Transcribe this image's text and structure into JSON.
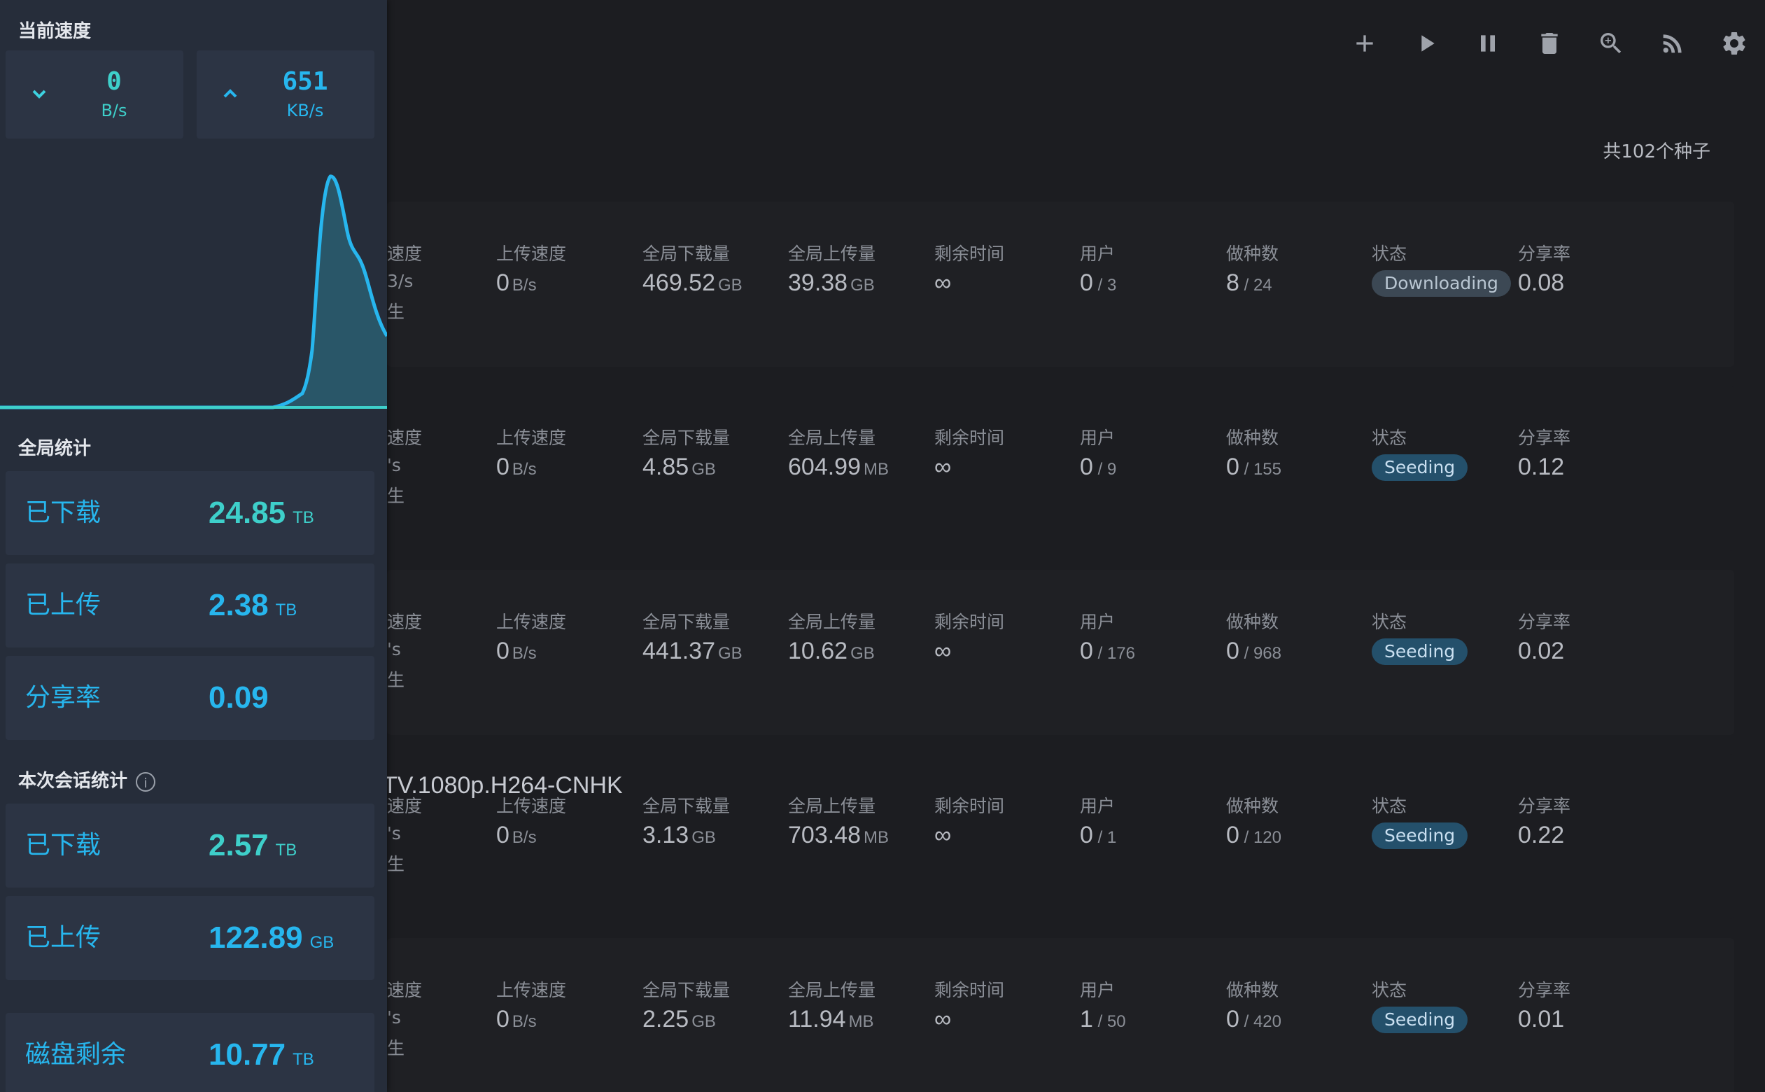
{
  "sidebar": {
    "speed_title": "当前速度",
    "download_speed": {
      "value": "0",
      "unit": "B/s"
    },
    "upload_speed": {
      "value": "651",
      "unit": "KB/s"
    },
    "global_title": "全局统计",
    "global": [
      {
        "label": "已下载",
        "value": "24.85",
        "unit": "TB"
      },
      {
        "label": "已上传",
        "value": "2.38",
        "unit": "TB"
      },
      {
        "label": "分享率",
        "value": "0.09",
        "unit": ""
      }
    ],
    "session_title": "本次会话统计",
    "session_info_icon": "info-icon",
    "session": [
      {
        "label": "已下载",
        "value": "2.57",
        "unit": "TB"
      },
      {
        "label": "已上传",
        "value": "122.89",
        "unit": "GB"
      }
    ],
    "disk": {
      "label": "磁盘剩余",
      "value": "10.77",
      "unit": "TB"
    }
  },
  "toolbar": {
    "icons": [
      "add-icon",
      "play-icon",
      "pause-icon",
      "delete-icon",
      "search-icon",
      "rss-icon",
      "gear-icon"
    ]
  },
  "total_label": "共102个种子",
  "columns": {
    "dl_speed": "速度",
    "ul_speed": "上传速度",
    "downloaded": "全局下载量",
    "uploaded": "全局上传量",
    "eta": "剩余时间",
    "peers": "用户",
    "seeds": "做种数",
    "status": "状态",
    "ratio": "分享率"
  },
  "torrents": [
    {
      "name": "",
      "dl_speed": "3/s",
      "extra": "生",
      "ul_value": "0",
      "ul_unit": "B/s",
      "downloaded": "469.52",
      "downloaded_unit": "GB",
      "uploaded": "39.38",
      "uploaded_unit": "GB",
      "eta": "∞",
      "peers": "0",
      "peers_total": "3",
      "seeds": "8",
      "seeds_total": "24",
      "status": "Downloading",
      "ratio": "0.08"
    },
    {
      "name": "",
      "dl_speed": "'s",
      "extra": "生",
      "ul_value": "0",
      "ul_unit": "B/s",
      "downloaded": "4.85",
      "downloaded_unit": "GB",
      "uploaded": "604.99",
      "uploaded_unit": "MB",
      "eta": "∞",
      "peers": "0",
      "peers_total": "9",
      "seeds": "0",
      "seeds_total": "155",
      "status": "Seeding",
      "ratio": "0.12"
    },
    {
      "name": "",
      "dl_speed": "'s",
      "extra": "生",
      "ul_value": "0",
      "ul_unit": "B/s",
      "downloaded": "441.37",
      "downloaded_unit": "GB",
      "uploaded": "10.62",
      "uploaded_unit": "GB",
      "eta": "∞",
      "peers": "0",
      "peers_total": "176",
      "seeds": "0",
      "seeds_total": "968",
      "status": "Seeding",
      "ratio": "0.02"
    },
    {
      "name": "TV.1080p.H264-CNHK",
      "dl_speed": "'s",
      "extra": "生",
      "ul_value": "0",
      "ul_unit": "B/s",
      "downloaded": "3.13",
      "downloaded_unit": "GB",
      "uploaded": "703.48",
      "uploaded_unit": "MB",
      "eta": "∞",
      "peers": "0",
      "peers_total": "1",
      "seeds": "0",
      "seeds_total": "120",
      "status": "Seeding",
      "ratio": "0.22"
    },
    {
      "name": "",
      "dl_speed": "'s",
      "extra": "生",
      "ul_value": "0",
      "ul_unit": "B/s",
      "downloaded": "2.25",
      "downloaded_unit": "GB",
      "uploaded": "11.94",
      "uploaded_unit": "MB",
      "eta": "∞",
      "peers": "1",
      "peers_total": "50",
      "seeds": "0",
      "seeds_total": "420",
      "status": "Seeding",
      "ratio": "0.01"
    }
  ],
  "colors": {
    "accent": "#27b6ee",
    "download": "#3ecfca",
    "seeding_badge": "#24506b",
    "sidebar_bg": "#262d3a"
  }
}
